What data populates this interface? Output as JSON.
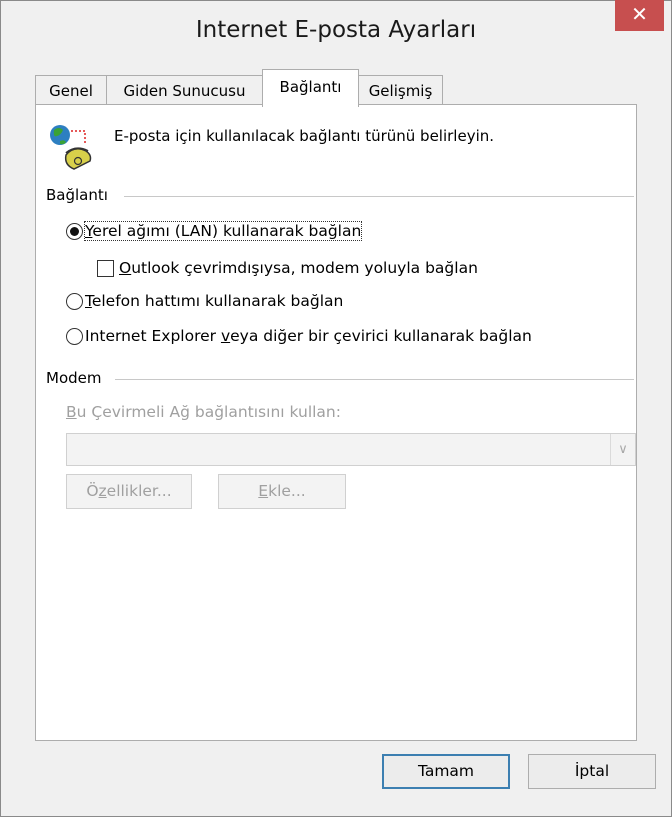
{
  "window": {
    "title": "Internet E-posta Ayarları",
    "close_glyph": "✕"
  },
  "tabs": [
    {
      "label": "Genel",
      "active": false
    },
    {
      "label": "Giden Sunucusu",
      "active": false
    },
    {
      "label": "Bağlantı",
      "active": true
    },
    {
      "label": "Gelişmiş",
      "active": false
    }
  ],
  "intro": {
    "text": "E-posta için kullanılacak bağlantı türünü belirleyin.",
    "icon": "globe-phone-icon"
  },
  "connection_group": {
    "label": "Bağlantı",
    "lan": {
      "access_key": "Y",
      "rest": "erel ağımı (LAN) kullanarak bağlan",
      "selected": true
    },
    "modem_fallback": {
      "access_key": "O",
      "rest": "utlook çevrimdışıysa, modem yoluyla bağlan",
      "checked": false
    },
    "phone": {
      "access_key": "T",
      "rest": "elefon hattımı kullanarak bağlan",
      "selected": false
    },
    "ie_dialer": {
      "before": "Internet Explorer ",
      "access_key": "v",
      "rest": "eya diğer bir çevirici kullanarak bağlan",
      "selected": false
    }
  },
  "modem_group": {
    "label": "Modem",
    "use_dialup_label": {
      "access_key": "B",
      "rest": "u Çevirmeli Ağ bağlantısını kullan:"
    },
    "dialup_value": "",
    "properties_button": {
      "before": "Ö",
      "access_key": "z",
      "rest": "ellikler..."
    },
    "add_button": {
      "access_key": "E",
      "rest": "kle..."
    }
  },
  "footer": {
    "ok_label": "Tamam",
    "cancel_label": "İptal"
  }
}
